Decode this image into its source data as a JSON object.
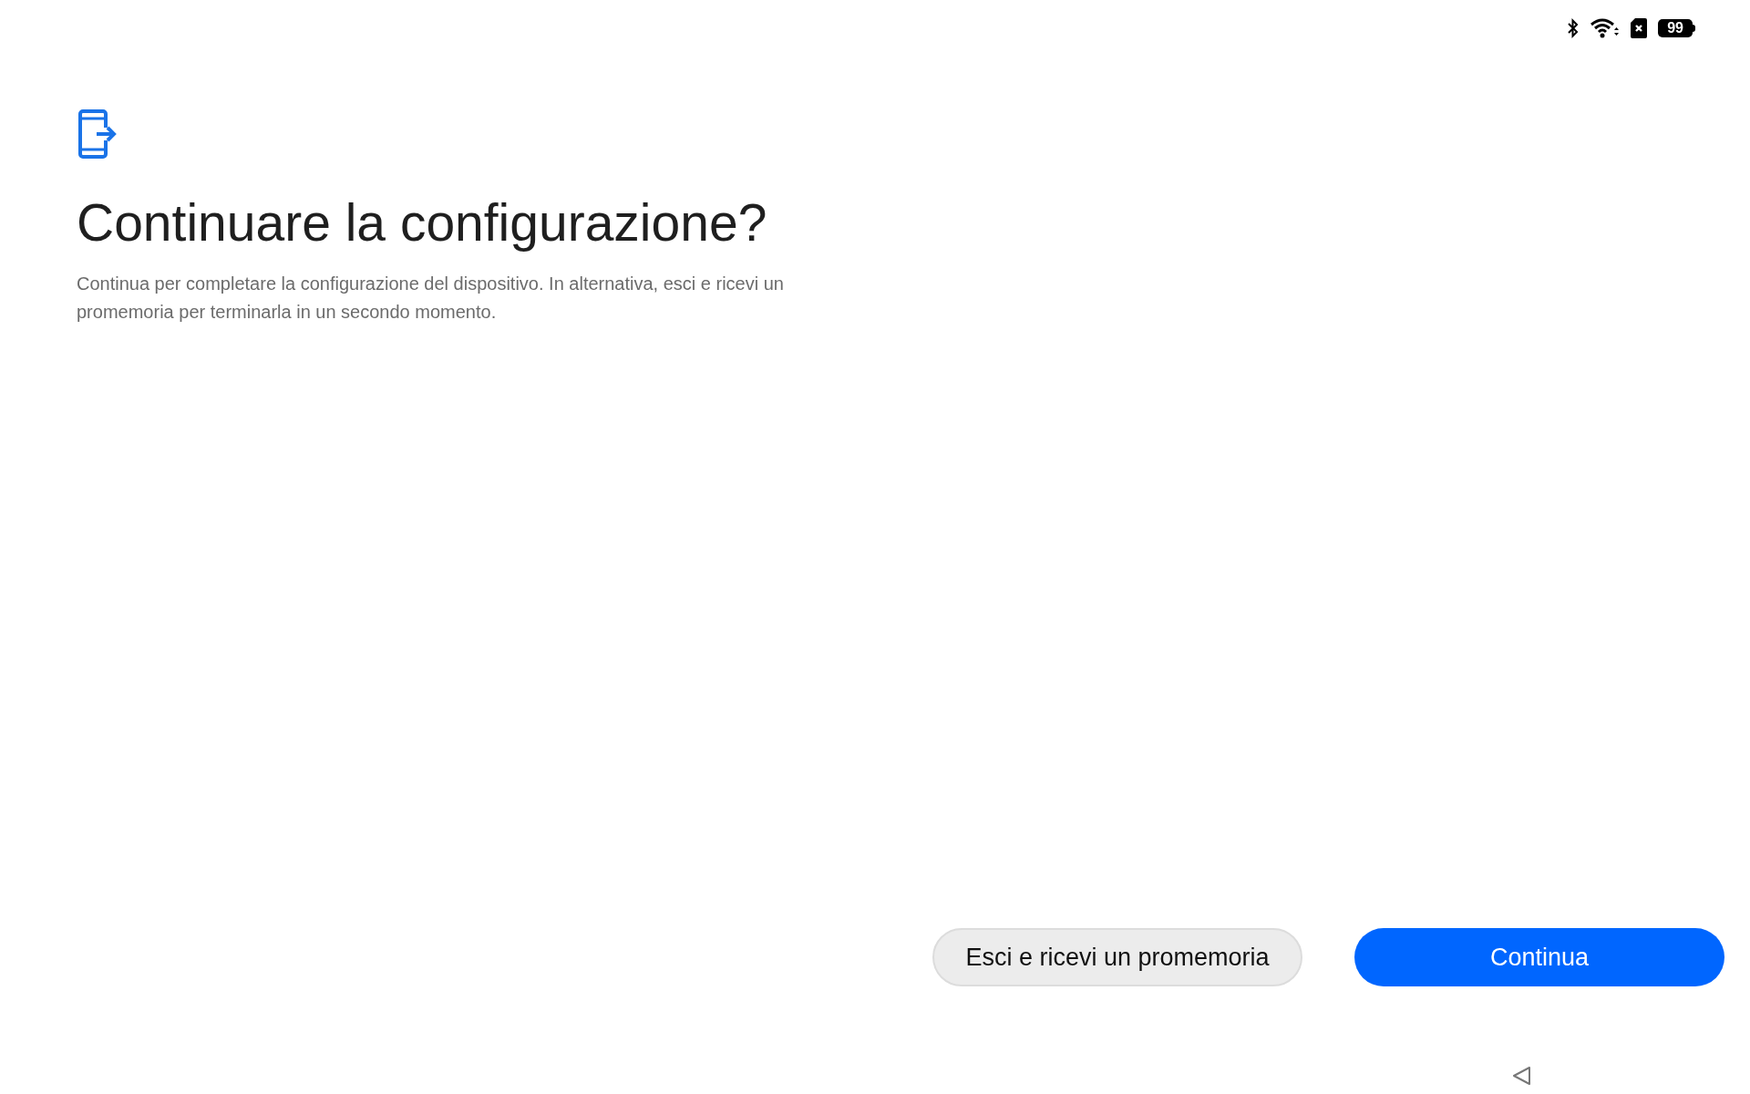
{
  "status_bar": {
    "battery": "99"
  },
  "title": "Continuare la configurazione?",
  "description": "Continua per completare la configurazione del dispositivo. In alternativa, esci e ricevi un promemoria per terminarla in un secondo momento.",
  "buttons": [
    {
      "label": "Esci e ricevi un promemoria",
      "kind": "secondary"
    },
    {
      "label": "Continua",
      "kind": "primary"
    }
  ]
}
